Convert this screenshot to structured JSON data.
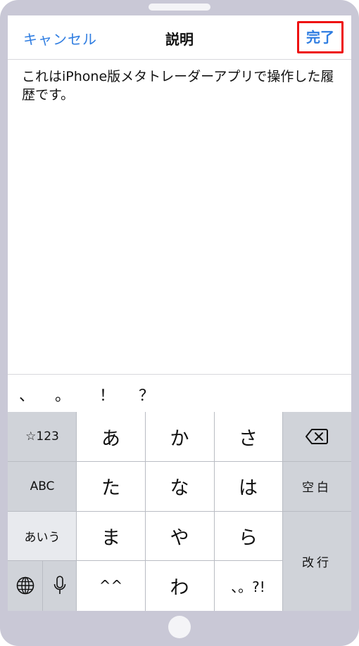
{
  "navbar": {
    "cancel_label": "キャンセル",
    "title": "説明",
    "done_label": "完了"
  },
  "description": {
    "text": "これはiPhone版メタトレーダーアプリで操作した履歴です。"
  },
  "suggestions": [
    "、",
    "。",
    "！",
    "？"
  ],
  "keyboard": {
    "row1": {
      "left": "☆123",
      "k1": "あ",
      "k2": "か",
      "k3": "さ"
    },
    "row2": {
      "left": "ABC",
      "k1": "た",
      "k2": "な",
      "k3": "は",
      "right": "空白"
    },
    "row3": {
      "left": "あいう",
      "k1": "ま",
      "k2": "や",
      "k3": "ら"
    },
    "row4": {
      "k1": "^^",
      "k2": "わ",
      "k3": "、。?!"
    },
    "return_label": "改行"
  },
  "colors": {
    "accent": "#2f7de1",
    "highlight": "#e11111",
    "frame": "#c9c8d6"
  }
}
